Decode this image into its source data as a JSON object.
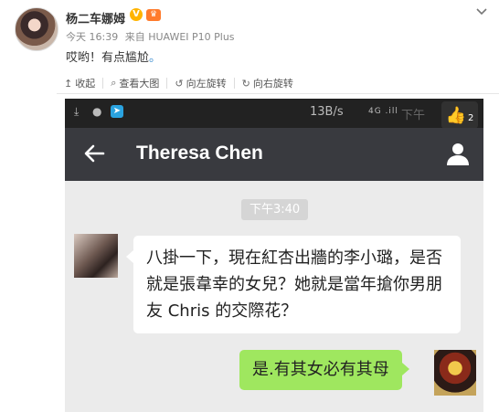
{
  "post": {
    "username": "杨二车娜姆",
    "vip": "V",
    "level": "♛",
    "time": "今天 16:39",
    "via": "来自 HUAWEI P10 Plus",
    "text": "哎哟！有点尴尬",
    "text_suffix": "。"
  },
  "toolbar": {
    "collapse": "收起",
    "view_large": "查看大图",
    "rotate_left": "向左旋转",
    "rotate_right": "向右旋转"
  },
  "phone": {
    "statusbar": {
      "speed": "13B/s",
      "signal": "4G .ill",
      "time": "下午"
    },
    "like": {
      "count": "2"
    },
    "chat_title": "Theresa Chen",
    "timestamp": "下午3:40",
    "messages": [
      {
        "side": "left",
        "text": "八掛一下，現在紅杏出牆的李小璐，是否就是張韋幸的女兒？她就是當年搶你男朋友 Chris 的交際花？"
      },
      {
        "side": "right",
        "text": "是.有其女必有其母"
      }
    ]
  }
}
